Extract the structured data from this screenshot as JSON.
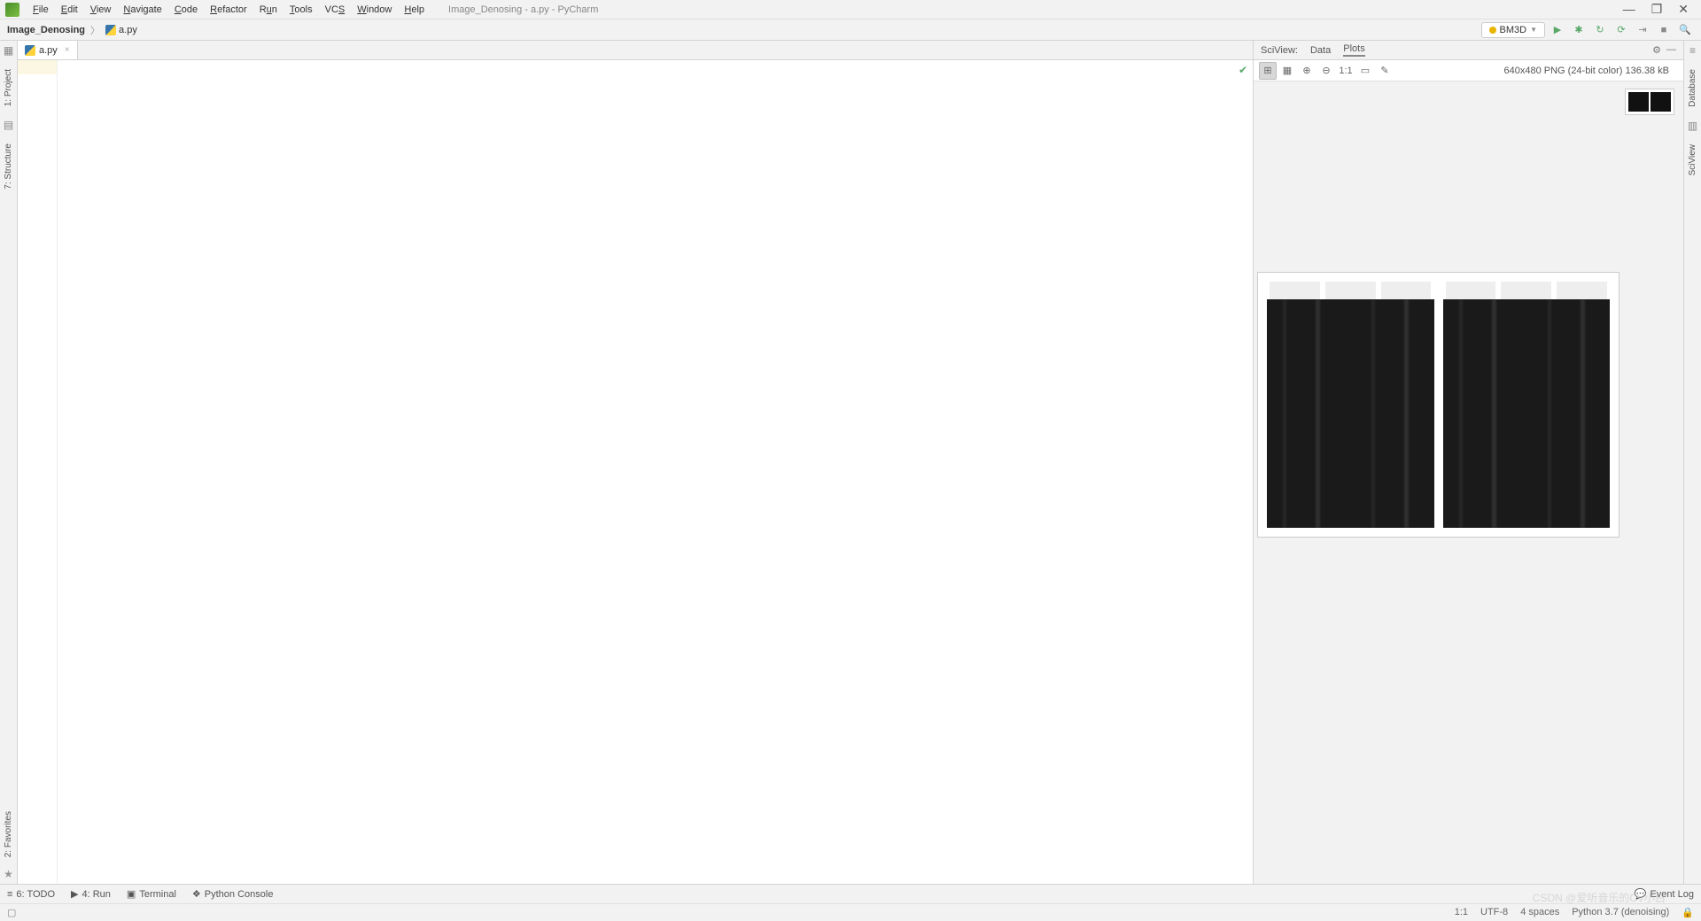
{
  "window": {
    "title": "Image_Denosing - a.py - PyCharm",
    "minimize": "—",
    "maximize": "❐",
    "close": "✕"
  },
  "menu": [
    "File",
    "Edit",
    "View",
    "Navigate",
    "Code",
    "Refactor",
    "Run",
    "Tools",
    "VCS",
    "Window",
    "Help"
  ],
  "breadcrumb": {
    "project": "Image_Denosing",
    "file": "a.py"
  },
  "run_config": "BM3D",
  "editor_tab": "a.py",
  "left_tools": {
    "project": "1: Project",
    "structure": "7: Structure"
  },
  "left_bottom": {
    "favorites": "2: Favorites"
  },
  "right_tools": {
    "database": "Database",
    "sciview": "SciView"
  },
  "sciview": {
    "label": "SciView:",
    "tab_data": "Data",
    "tab_plots": "Plots",
    "info": "640x480 PNG (24-bit color) 136.38 kB",
    "ratio": "1:1"
  },
  "bottom": {
    "todo": "6: TODO",
    "run": "4: Run",
    "terminal": "Terminal",
    "python_console": "Python Console",
    "event_log": "Event Log"
  },
  "status": {
    "pos": "1:1",
    "encoding": "UTF-8",
    "indent": "4 spaces",
    "interpreter": "Python 3.7 (denoising)"
  },
  "watermark": "CSDN @爱听音乐的CV小白"
}
